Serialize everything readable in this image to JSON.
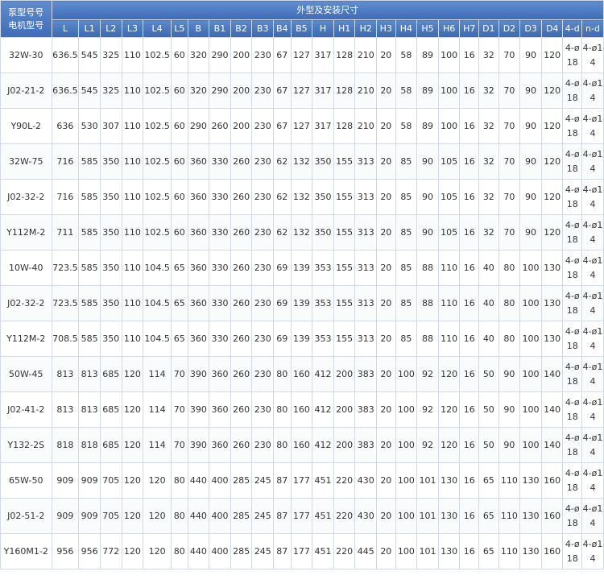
{
  "header": {
    "model_label": "泵型号号\n电机型号",
    "group_label": "外型及安装尺寸",
    "columns": [
      "L",
      "L1",
      "L2",
      "L3",
      "L4",
      "L5",
      "B",
      "B1",
      "B2",
      "B3",
      "B4",
      "B5",
      "H",
      "H1",
      "H2",
      "H3",
      "H4",
      "H5",
      "H6",
      "H7",
      "D1",
      "D2",
      "D3",
      "D4",
      "4-d",
      "n-d"
    ]
  },
  "rows": [
    [
      "32W-30",
      "636.5",
      "545",
      "325",
      "110",
      "102.5",
      "60",
      "320",
      "290",
      "200",
      "230",
      "67",
      "127",
      "317",
      "128",
      "210",
      "20",
      "58",
      "89",
      "100",
      "16",
      "32",
      "70",
      "90",
      "120",
      "4-ø18",
      "4-ø14"
    ],
    [
      "J02-21-2",
      "636.5",
      "545",
      "325",
      "110",
      "102.5",
      "60",
      "320",
      "290",
      "200",
      "230",
      "67",
      "127",
      "317",
      "128",
      "210",
      "20",
      "58",
      "89",
      "100",
      "16",
      "32",
      "70",
      "90",
      "120",
      "4-ø18",
      "4-ø14"
    ],
    [
      "Y90L-2",
      "636",
      "530",
      "307",
      "110",
      "102.5",
      "60",
      "290",
      "260",
      "200",
      "230",
      "67",
      "127",
      "317",
      "128",
      "210",
      "20",
      "58",
      "89",
      "100",
      "16",
      "32",
      "70",
      "90",
      "120",
      "4-ø18",
      "4-ø14"
    ],
    [
      "32W-75",
      "716",
      "585",
      "350",
      "110",
      "102.5",
      "60",
      "360",
      "330",
      "260",
      "230",
      "62",
      "132",
      "350",
      "155",
      "313",
      "20",
      "85",
      "90",
      "105",
      "16",
      "32",
      "70",
      "90",
      "120",
      "4-ø18",
      "4-ø14"
    ],
    [
      "J02-32-2",
      "716",
      "585",
      "350",
      "110",
      "102.5",
      "60",
      "360",
      "330",
      "260",
      "230",
      "62",
      "132",
      "350",
      "155",
      "313",
      "20",
      "85",
      "90",
      "105",
      "16",
      "32",
      "70",
      "90",
      "120",
      "4-ø18",
      "4-ø14"
    ],
    [
      "Y112M-2",
      "711",
      "585",
      "350",
      "110",
      "102.5",
      "60",
      "360",
      "330",
      "260",
      "230",
      "62",
      "132",
      "350",
      "155",
      "313",
      "20",
      "85",
      "90",
      "105",
      "16",
      "32",
      "70",
      "90",
      "120",
      "4-ø18",
      "4-ø14"
    ],
    [
      "10W-40",
      "723.5",
      "585",
      "350",
      "110",
      "104.5",
      "65",
      "360",
      "330",
      "260",
      "230",
      "69",
      "139",
      "353",
      "155",
      "313",
      "20",
      "85",
      "88",
      "110",
      "16",
      "40",
      "80",
      "100",
      "130",
      "4-ø18",
      "4-ø14"
    ],
    [
      "J02-32-2",
      "723.5",
      "585",
      "350",
      "110",
      "104.5",
      "65",
      "360",
      "330",
      "260",
      "230",
      "69",
      "139",
      "353",
      "155",
      "313",
      "20",
      "85",
      "88",
      "110",
      "16",
      "40",
      "80",
      "100",
      "130",
      "4-ø18",
      "4-ø14"
    ],
    [
      "Y112M-2",
      "708.5",
      "585",
      "350",
      "110",
      "104.5",
      "65",
      "360",
      "330",
      "260",
      "230",
      "69",
      "139",
      "353",
      "155",
      "313",
      "20",
      "85",
      "88",
      "110",
      "16",
      "40",
      "80",
      "100",
      "130",
      "4-ø18",
      "4-ø14"
    ],
    [
      "50W-45",
      "813",
      "813",
      "685",
      "120",
      "114",
      "70",
      "390",
      "360",
      "260",
      "230",
      "80",
      "160",
      "412",
      "200",
      "383",
      "20",
      "100",
      "92",
      "120",
      "16",
      "50",
      "90",
      "100",
      "140",
      "4-ø18",
      "4-ø14"
    ],
    [
      "J02-41-2",
      "813",
      "813",
      "685",
      "120",
      "114",
      "70",
      "390",
      "360",
      "260",
      "230",
      "80",
      "160",
      "412",
      "200",
      "383",
      "20",
      "100",
      "92",
      "120",
      "16",
      "50",
      "90",
      "100",
      "140",
      "4-ø18",
      "4-ø14"
    ],
    [
      "Y132-2S",
      "818",
      "818",
      "685",
      "120",
      "114",
      "70",
      "390",
      "360",
      "260",
      "230",
      "80",
      "160",
      "412",
      "200",
      "383",
      "20",
      "100",
      "92",
      "120",
      "16",
      "50",
      "90",
      "100",
      "140",
      "4-ø18",
      "4-ø14"
    ],
    [
      "65W-50",
      "909",
      "909",
      "705",
      "120",
      "120",
      "80",
      "440",
      "400",
      "285",
      "245",
      "87",
      "177",
      "451",
      "220",
      "430",
      "20",
      "100",
      "101",
      "130",
      "16",
      "65",
      "110",
      "130",
      "160",
      "4-ø18",
      "4-ø14"
    ],
    [
      "J02-51-2",
      "909",
      "909",
      "705",
      "120",
      "120",
      "80",
      "440",
      "400",
      "285",
      "245",
      "87",
      "177",
      "451",
      "220",
      "430",
      "20",
      "100",
      "101",
      "130",
      "16",
      "65",
      "110",
      "130",
      "160",
      "4-ø18",
      "4-ø14"
    ],
    [
      "Y160M1-2",
      "956",
      "956",
      "772",
      "120",
      "120",
      "80",
      "440",
      "400",
      "285",
      "245",
      "87",
      "177",
      "451",
      "220",
      "445",
      "20",
      "100",
      "101",
      "130",
      "16",
      "65",
      "110",
      "130",
      "160",
      "4-ø18",
      "4-ø14"
    ]
  ]
}
